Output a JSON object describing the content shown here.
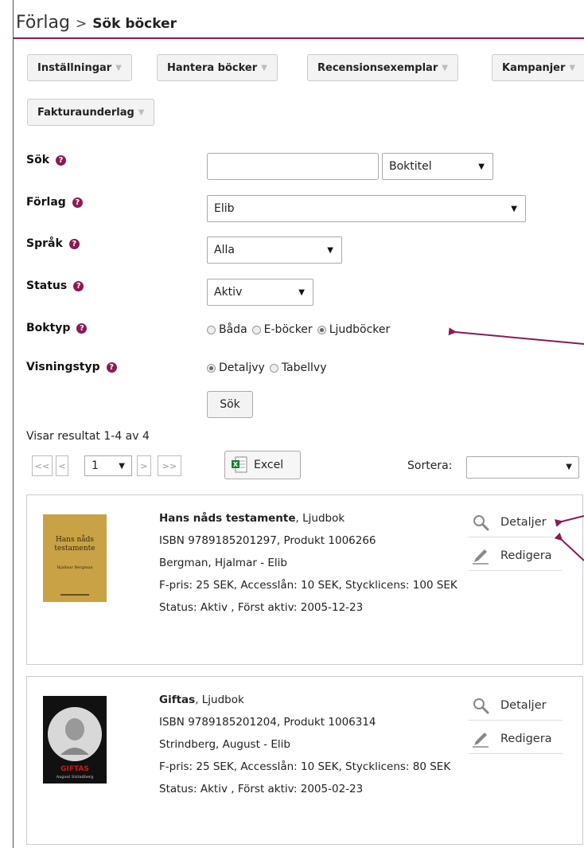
{
  "header": {
    "parent": "Förlag",
    "separator": ">",
    "current": "Sök böcker"
  },
  "menus": [
    {
      "label": "Inställningar"
    },
    {
      "label": "Hantera böcker"
    },
    {
      "label": "Recensionsexemplar"
    },
    {
      "label": "Kampanjer"
    },
    {
      "label": "Fakturaunderlag"
    }
  ],
  "form": {
    "search": {
      "label": "Sök",
      "value": "",
      "type_selected": "Boktitel"
    },
    "publisher": {
      "label": "Förlag",
      "selected": "Elib"
    },
    "language": {
      "label": "Språk",
      "selected": "Alla"
    },
    "status": {
      "label": "Status",
      "selected": "Aktiv"
    },
    "booktype": {
      "label": "Boktyp",
      "options": [
        "Båda",
        "E-böcker",
        "Ljudböcker"
      ],
      "selected": "Ljudböcker"
    },
    "viewtype": {
      "label": "Visningstyp",
      "options": [
        "Detaljvy",
        "Tabellvy"
      ],
      "selected": "Detaljvy"
    },
    "submit_label": "Sök"
  },
  "results": {
    "summary": "Visar resultat 1-4 av 4",
    "pager": {
      "first": "<<",
      "prev": "<",
      "page": "1",
      "next": ">",
      "last": ">>"
    },
    "excel_label": "Excel",
    "sort_label": "Sortera:",
    "items": [
      {
        "title": "Hans nåds testamente",
        "type": ", Ljudbok",
        "isbn_line": "ISBN 9789185201297, Produkt 1006266",
        "author_line": "Bergman, Hjalmar - Elib",
        "price_line": "F-pris: 25 SEK, Accesslån: 10 SEK, Stycklicens: 100 SEK",
        "status_line": "Status: Aktiv , Först aktiv: 2005-12-23",
        "cover_title": "Hans nåds testamente",
        "cover_author": "Hjalmar Bergman",
        "cover_color": "#c8a244",
        "details_label": "Detaljer",
        "edit_label": "Redigera"
      },
      {
        "title": "Giftas",
        "type": ", Ljudbok",
        "isbn_line": "ISBN 9789185201204, Produkt 1006314",
        "author_line": "Strindberg, August - Elib",
        "price_line": "F-pris: 25 SEK, Accesslån: 10 SEK, Stycklicens: 80 SEK",
        "status_line": "Status: Aktiv , Först aktiv: 2005-02-23",
        "cover_title": "GIFTAS",
        "cover_author": "August Strindberg",
        "cover_color": "#111111",
        "details_label": "Detaljer",
        "edit_label": "Redigera"
      }
    ]
  },
  "colors": {
    "accent": "#8b1a56"
  }
}
